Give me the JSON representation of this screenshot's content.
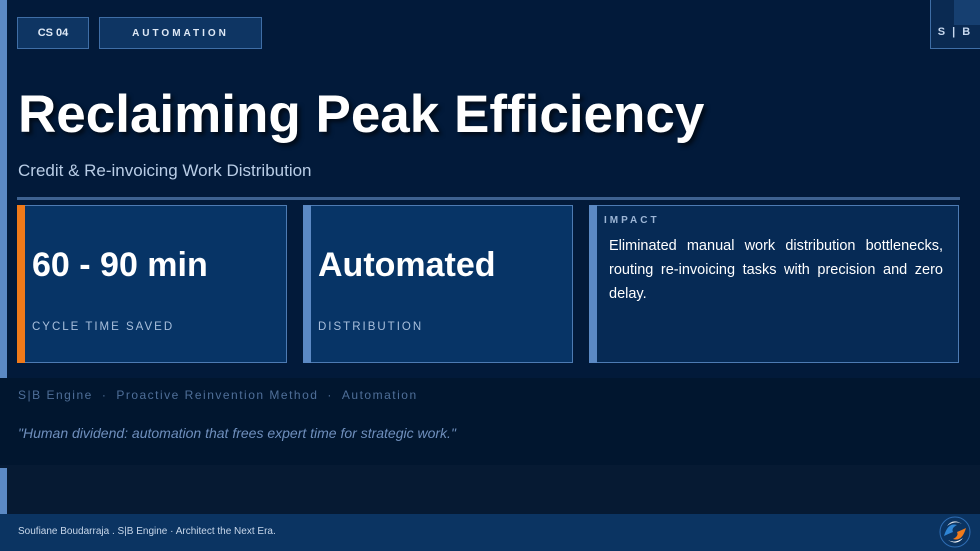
{
  "header": {
    "case_tag": "CS 04",
    "category": "AUTOMATION",
    "brand_mark": "S | B"
  },
  "hero": {
    "title": "Reclaiming Peak Efficiency",
    "subtitle": "Credit & Re-invoicing Work Distribution"
  },
  "metrics": [
    {
      "value": "60 - 90 min",
      "label": "CYCLE TIME SAVED",
      "accent": "#f07a1a"
    },
    {
      "value": "Automated",
      "label": "DISTRIBUTION",
      "accent": "#5b89c4"
    }
  ],
  "impact": {
    "label": "IMPACT",
    "text": "Eliminated manual work distribution bottlenecks, routing re-invoicing tasks with precision and zero delay."
  },
  "meta": {
    "engine": "S|B Engine",
    "method": "Proactive Reinvention Method",
    "category": "Automation",
    "separator": "·"
  },
  "quote": "\"Human dividend: automation that frees expert time for strategic work.\"",
  "footer": {
    "text": "Soufiane Boudarraja .  S|B  Engine ·  Architect the Next Era.",
    "logo_icon": "sb-logo-icon"
  },
  "colors": {
    "background": "#021a3a",
    "accent_orange": "#f07a1a",
    "accent_blue": "#5b89c4",
    "card_fill": "#073466"
  }
}
